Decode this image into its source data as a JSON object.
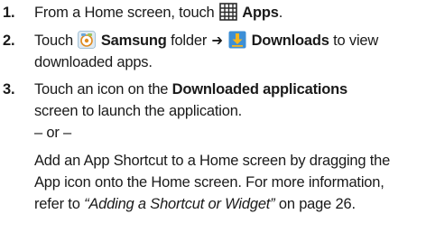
{
  "steps": [
    {
      "number": "1.",
      "pre": "From a Home screen, touch ",
      "icon": "apps-grid-icon",
      "strong": "Apps",
      "post": "."
    },
    {
      "number": "2.",
      "pre": "Touch ",
      "icon1": "samsung-folder-icon",
      "strong1": "Samsung",
      "mid": " folder ",
      "arrow": "➔",
      "icon2": "downloads-icon",
      "strong2": "Downloads",
      "post": " to view",
      "line2": "downloaded apps."
    },
    {
      "number": "3.",
      "pre": "Touch an icon on the ",
      "strong": "Downloaded applications",
      "line2": "screen to launch the application.",
      "or": "– or –",
      "line4": "Add an App Shortcut to a Home screen by dragging the",
      "line5": "App icon onto the Home screen. For more information,",
      "line6_pre": "refer to ",
      "line6_link": "“Adding a Shortcut or Widget”",
      "line6_post": " on page 26."
    }
  ],
  "colors": {
    "apps_icon": "#2a2a2a",
    "folder_bg": "#d8e6f0",
    "downloads_bg": "#3d8fd6",
    "downloads_arrow": "#f6b51e"
  }
}
